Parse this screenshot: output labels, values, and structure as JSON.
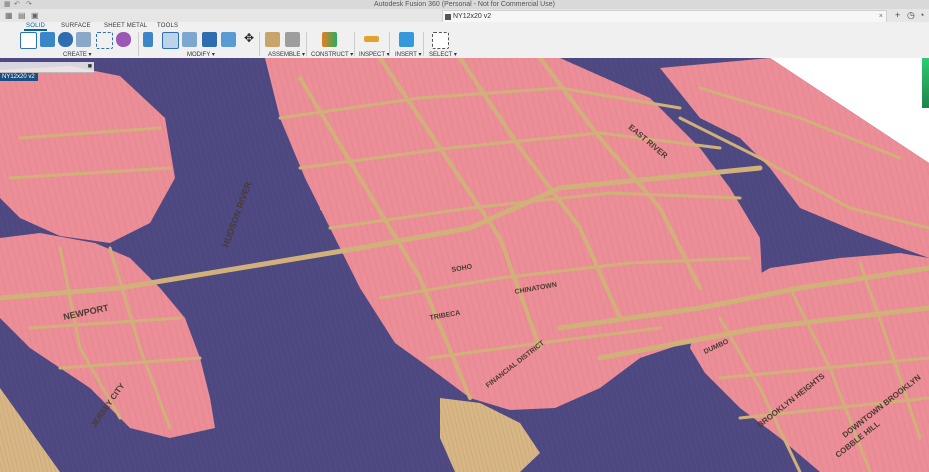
{
  "window": {
    "title": "Autodesk Fusion 360 (Personal - Not for Commercial Use)",
    "document_tab": "NY12x20 v2"
  },
  "ribbon": {
    "tabs": [
      {
        "label": "SOLID",
        "active": true
      },
      {
        "label": "SURFACE",
        "active": false
      },
      {
        "label": "SHEET METAL",
        "active": false
      },
      {
        "label": "TOOLS",
        "active": false
      }
    ],
    "groups": {
      "create": "CREATE ▾",
      "modify": "MODIFY ▾",
      "assemble": "ASSEMBLE ▾",
      "construct": "CONSTRUCT ▾",
      "inspect": "INSPECT ▾",
      "insert": "INSERT ▾",
      "select": "SELECT ▾"
    }
  },
  "browser": {
    "root_label": "NY12x20 v2"
  },
  "map": {
    "labels": {
      "hudson": "HUDSON RIVER",
      "east": "EAST RIVER",
      "newport": "NEWPORT",
      "jersey_city": "JERSEY CITY",
      "brooklyn_heights": "BROOKLYN HEIGHTS",
      "downtown_brooklyn": "DOWNTOWN BROOKLYN",
      "cobble_hill": "COBBLE HILL",
      "financial_district": "FINANCIAL DISTRICT",
      "tribeca": "TRIBECA",
      "soho": "SOHO",
      "chinatown": "CHINATOWN",
      "dumbo": "DUMBO"
    },
    "colors": {
      "land": "#ec8e97",
      "water": "#4d4880",
      "streets": "#d2b079",
      "edge": "#c9a06a"
    }
  }
}
